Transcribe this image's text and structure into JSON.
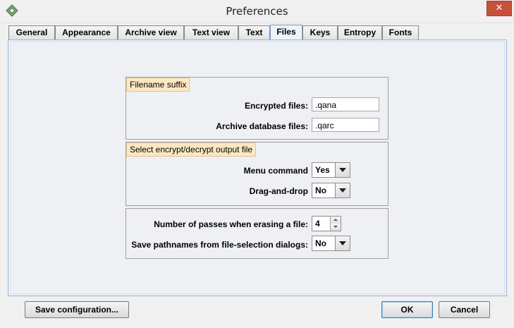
{
  "window": {
    "title": "Preferences",
    "close_glyph": "✕"
  },
  "tabs": [
    {
      "label": "General"
    },
    {
      "label": "Appearance"
    },
    {
      "label": "Archive view"
    },
    {
      "label": "Text view"
    },
    {
      "label": "Text"
    },
    {
      "label": "Files",
      "active": true
    },
    {
      "label": "Keys"
    },
    {
      "label": "Entropy"
    },
    {
      "label": "Fonts"
    }
  ],
  "filename_suffix": {
    "title": "Filename suffix",
    "encrypted_label": "Encrypted files:",
    "encrypted_value": ".qana",
    "archive_label": "Archive database files:",
    "archive_value": ".qarc"
  },
  "output_file": {
    "title": "Select encrypt/decrypt output file",
    "menu_label": "Menu command",
    "menu_value": "Yes",
    "drag_label": "Drag-and-drop",
    "drag_value": "No"
  },
  "misc": {
    "passes_label": "Number of passes when erasing a file:",
    "passes_value": "4",
    "save_paths_label": "Save pathnames from file-selection dialogs:",
    "save_paths_value": "No"
  },
  "buttons": {
    "save_config": "Save configuration...",
    "ok": "OK",
    "cancel": "Cancel"
  },
  "colors": {
    "group_title_bg": "#fbe8c3",
    "active_tab_border": "#7a9cc4",
    "close_button": "#c7503a"
  },
  "icons": [
    "app-icon",
    "close-icon",
    "chevron-down-icon",
    "spinner-up-icon",
    "spinner-down-icon"
  ]
}
